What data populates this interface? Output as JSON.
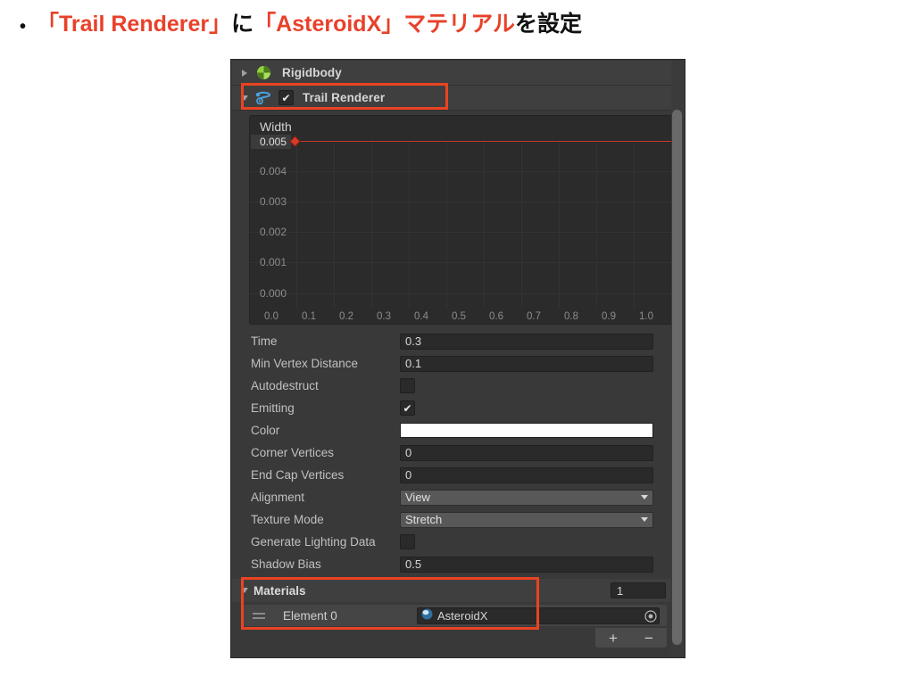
{
  "slide": {
    "bullet": "•",
    "title_parts": [
      {
        "text": "「Trail Renderer」",
        "accent": true
      },
      {
        "text": "に",
        "accent": false
      },
      {
        "text": "「AsteroidX」マテリアル",
        "accent": true
      },
      {
        "text": "を設定",
        "accent": false
      }
    ]
  },
  "inspector": {
    "components": [
      {
        "name": "Rigidbody",
        "icon": "rigidbody-icon",
        "expanded": false,
        "has_enable_checkbox": false
      },
      {
        "name": "Trail Renderer",
        "icon": "trail-renderer-icon",
        "expanded": true,
        "has_enable_checkbox": true,
        "enabled": true
      }
    ],
    "header_icons": [
      "help-icon",
      "preset-icon",
      "menu-icon"
    ],
    "curve": {
      "label": "Width",
      "y_ticks": [
        "0.005",
        "0.004",
        "0.003",
        "0.002",
        "0.001",
        "0.000"
      ],
      "x_ticks": [
        "0.0",
        "0.1",
        "0.2",
        "0.3",
        "0.4",
        "0.5",
        "0.6",
        "0.7",
        "0.8",
        "0.9",
        "1.0"
      ],
      "curve_color": "#c0392b",
      "constant_value": "0.005"
    },
    "properties": [
      {
        "label": "Time",
        "type": "text",
        "value": "0.3"
      },
      {
        "label": "Min Vertex Distance",
        "type": "text",
        "value": "0.1"
      },
      {
        "label": "Autodestruct",
        "type": "checkbox",
        "value": false
      },
      {
        "label": "Emitting",
        "type": "checkbox",
        "value": true
      },
      {
        "label": "Color",
        "type": "color",
        "value": "#ffffff"
      },
      {
        "label": "Corner Vertices",
        "type": "text",
        "value": "0"
      },
      {
        "label": "End Cap Vertices",
        "type": "text",
        "value": "0"
      },
      {
        "label": "Alignment",
        "type": "dropdown",
        "value": "View"
      },
      {
        "label": "Texture Mode",
        "type": "dropdown",
        "value": "Stretch"
      },
      {
        "label": "Generate Lighting Data",
        "type": "checkbox",
        "value": false
      },
      {
        "label": "Shadow Bias",
        "type": "text",
        "value": "0.5"
      }
    ],
    "materials": {
      "title": "Materials",
      "size": "1",
      "element_label": "Element 0",
      "element_value": "AsteroidX",
      "add_label": "+",
      "remove_label": "−"
    }
  },
  "annotations": {
    "accent_color": "#ea4322",
    "boxes": [
      "trail-renderer-header",
      "materials-element"
    ]
  }
}
